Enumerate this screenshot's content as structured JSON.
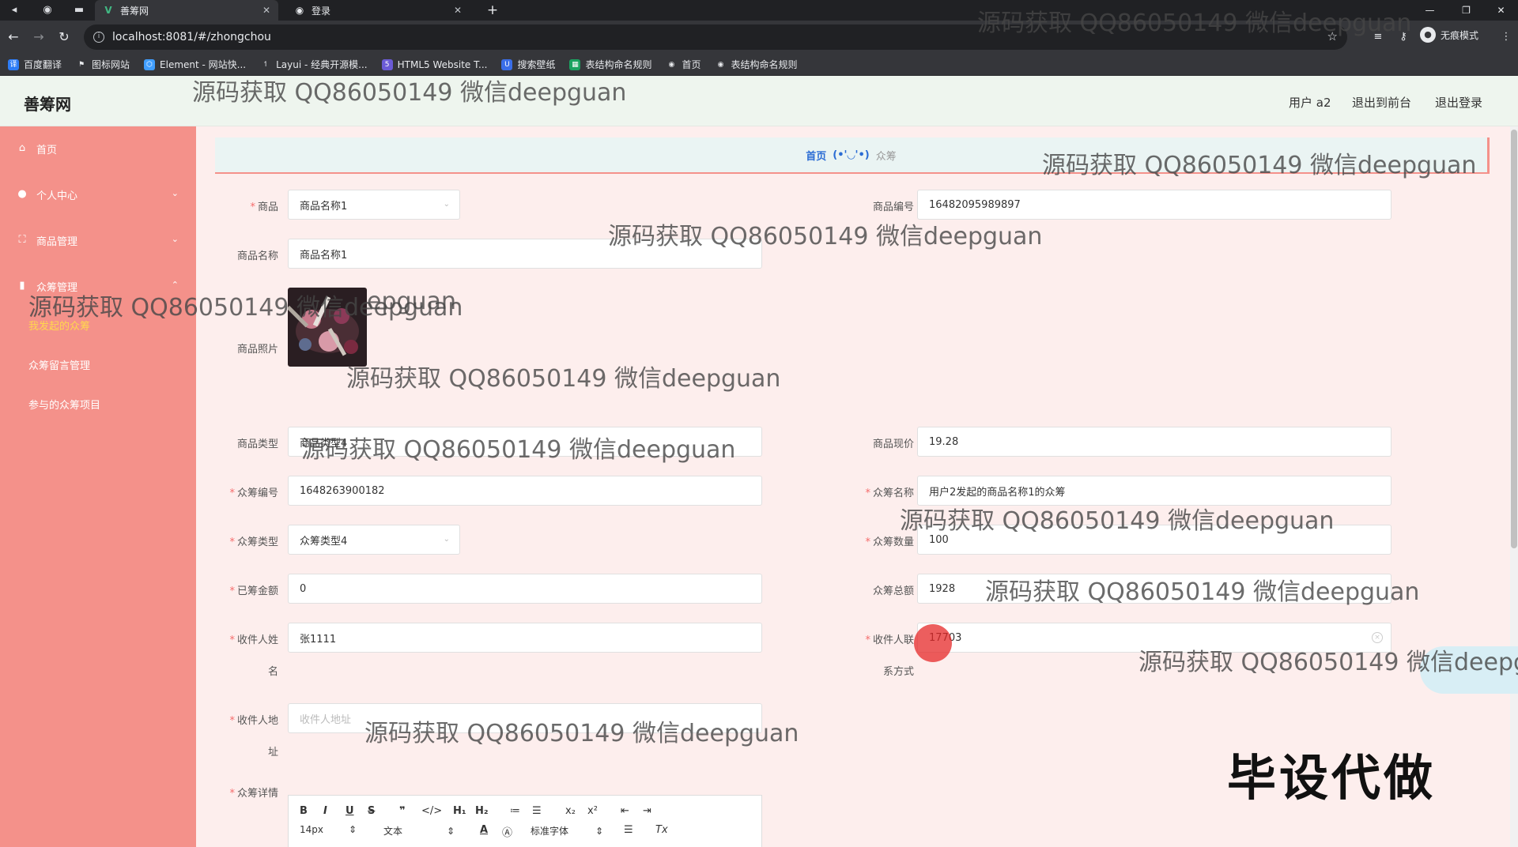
{
  "browser": {
    "tabs": [
      {
        "title": "善筹网",
        "active": true,
        "icon": "vue-icon"
      },
      {
        "title": "登录",
        "active": false,
        "icon": "globe-icon"
      }
    ],
    "url": "localhost:8081/#/zhongchou",
    "profile_label": "无痕模式",
    "bookmarks": [
      {
        "label": "百度翻译",
        "icon": "translate-icon",
        "color": "#2d7cf6"
      },
      {
        "label": "图标网站",
        "icon": "flag-icon",
        "color": "#444444"
      },
      {
        "label": "Element - 网站快...",
        "icon": "element-icon",
        "color": "#409eff"
      },
      {
        "label": "Layui - 经典开源模...",
        "icon": "layui-icon",
        "color": "#666666"
      },
      {
        "label": "HTML5 Website T...",
        "icon": "html5-icon",
        "color": "#6b5bd6"
      },
      {
        "label": "搜索壁纸",
        "icon": "wallpaper-icon",
        "color": "#3a6ee8"
      },
      {
        "label": "表结构命名规则",
        "icon": "table-icon",
        "color": "#1aa260"
      },
      {
        "label": "首页",
        "icon": "globe-icon",
        "color": "#555555"
      },
      {
        "label": "表结构命名规则",
        "icon": "globe-icon",
        "color": "#555555"
      }
    ]
  },
  "header": {
    "brand": "善筹网",
    "user": "用户 a2",
    "back_to_front": "退出到前台",
    "logout": "退出登录"
  },
  "sidebar": {
    "items": [
      {
        "label": "首页",
        "icon": "home-icon"
      },
      {
        "label": "个人中心",
        "icon": "user-icon"
      },
      {
        "label": "商品管理",
        "icon": "goods-icon"
      },
      {
        "label": "众筹管理",
        "icon": "chart-icon"
      }
    ],
    "submenu": [
      {
        "label": "我发起的众筹",
        "active": true
      },
      {
        "label": "众筹留言管理",
        "active": false
      },
      {
        "label": "参与的众筹项目",
        "active": false
      }
    ]
  },
  "breadcrumb": {
    "home": "首页",
    "face": "(•'◡'•)",
    "current": "众筹"
  },
  "form": {
    "shangpin_label": "商品",
    "shangpin_value": "商品名称1",
    "bianhao_label": "商品编号",
    "bianhao_value": "16482095989897",
    "mingcheng_label": "商品名称",
    "mingcheng_value": "商品名称1",
    "zhaopian_label": "商品照片",
    "leixing_label": "商品类型",
    "leixing_value": "商品类型4",
    "xianjia_label": "商品现价",
    "xianjia_value": "19.28",
    "zc_bianhao_label": "众筹编号",
    "zc_bianhao_value": "1648263900182",
    "zc_mingcheng_label": "众筹名称",
    "zc_mingcheng_value": "用户2发起的商品名称1的众筹",
    "zc_leixing_label": "众筹类型",
    "zc_leixing_value": "众筹类型4",
    "zc_shuliang_label": "众筹数量",
    "zc_shuliang_value": "100",
    "yichou_label": "已筹金额",
    "yichou_value": "0",
    "zonge_label": "众筹总额",
    "zonge_value": "1928",
    "shoujian_xingming_label_1": "收件人姓",
    "shoujian_xingming_label_2": "名",
    "shoujian_xingming_value": "张1111",
    "lianxi_label_1": "收件人联",
    "lianxi_label_2": "系方式",
    "lianxi_value": "17703",
    "dizhi_label_1": "收件人地",
    "dizhi_label_2": "址",
    "dizhi_placeholder": "收件人地址",
    "xiangqing_label": "众筹详情"
  },
  "editor": {
    "font_size": "14px",
    "text_style": "文本",
    "font_family": "标准字体"
  },
  "watermarks": {
    "text": "源码获取 QQ86050149 微信deepguan",
    "fragment": "epguan",
    "cut": "源码获取 QQ86050149 微信deepg",
    "banner": "毕设代做"
  }
}
